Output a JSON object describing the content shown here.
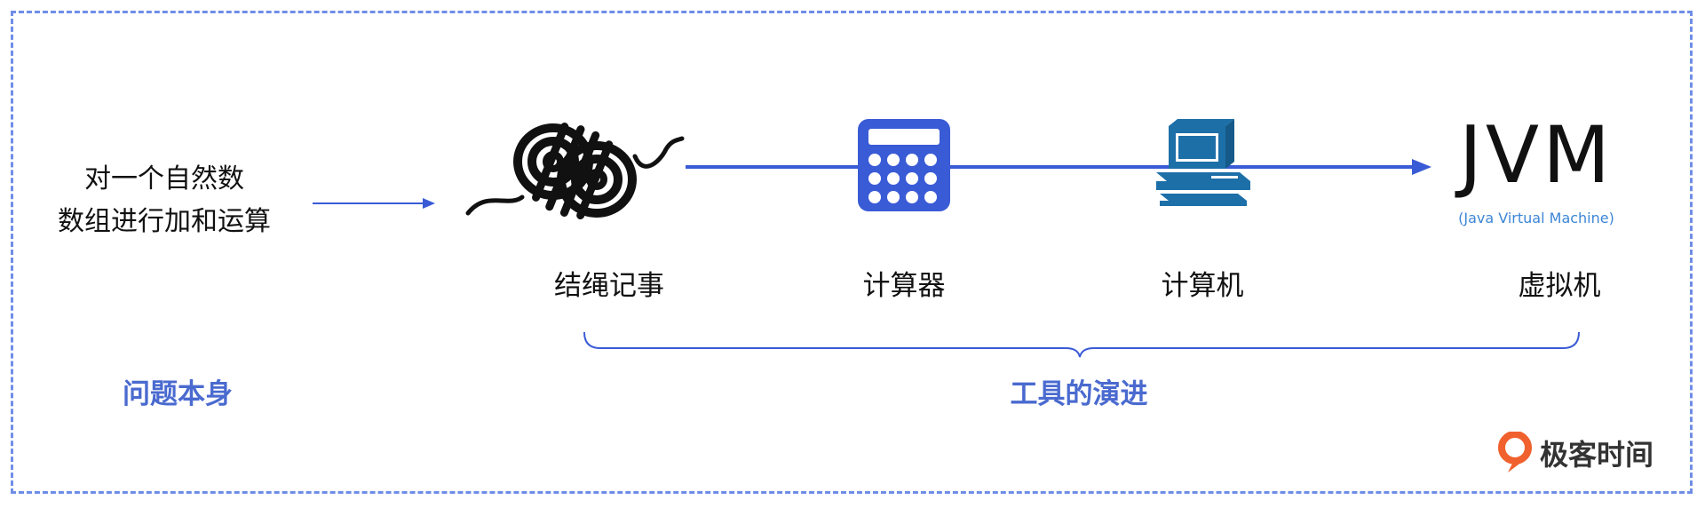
{
  "problem": {
    "line1": "对一个自然数",
    "line2": "数组进行加和运算"
  },
  "tools": [
    {
      "label": "结绳记事",
      "icon": "knotted-rope-icon"
    },
    {
      "label": "计算器",
      "icon": "calculator-icon"
    },
    {
      "label": "计算机",
      "icon": "computer-icon"
    },
    {
      "label": "虚拟机",
      "icon": "jvm-logo"
    }
  ],
  "jvm": {
    "title": "JVM",
    "subtitle": "(Java Virtual Machine)"
  },
  "sections": {
    "problem": "问题本身",
    "evolution": "工具的演进"
  },
  "brand": {
    "name": "极客时间"
  },
  "colors": {
    "accent": "#3a5bd6",
    "section": "#4a6acf",
    "frame": "#6f8ee6",
    "brand": "#f0612d",
    "jvm_sub": "#3d86d6",
    "computer": "#1d6fa8"
  }
}
